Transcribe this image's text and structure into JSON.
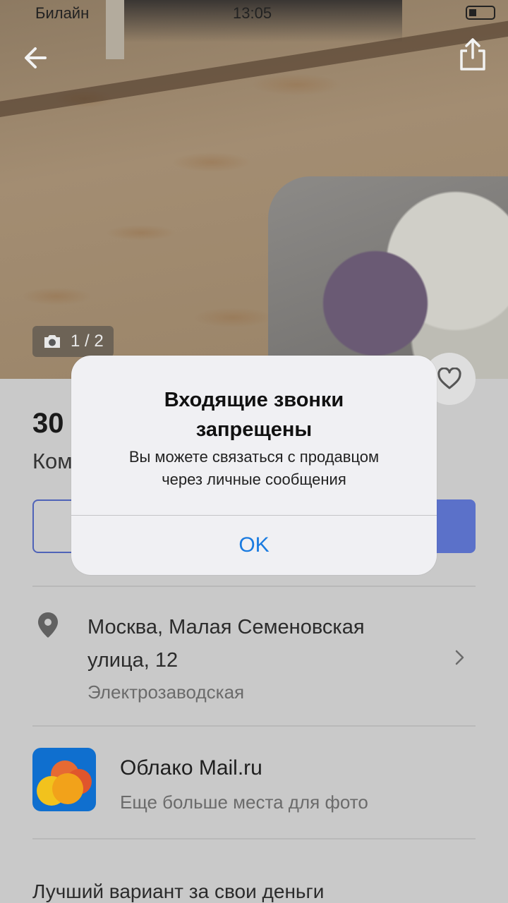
{
  "status_bar": {
    "carrier": "Билайн",
    "time": "13:05"
  },
  "gallery": {
    "counter": "1 / 2"
  },
  "listing": {
    "price": "30",
    "subtitle": "Ком"
  },
  "location": {
    "address_line1": "Москва, Малая Семеновская",
    "address_line2": "улица, 12",
    "metro": "Электрозаводская"
  },
  "promo": {
    "title": "Облако Mail.ru",
    "subtitle": "Еще больше места для фото"
  },
  "description": {
    "first_line": "Лучший вариант за свои деньги"
  },
  "alert": {
    "title_line1": "Входящие звонки",
    "title_line2": "запрещены",
    "message_line1": "Вы можете связаться с продавцом",
    "message_line2": "через личные сообщения",
    "ok_label": "OK"
  },
  "colors": {
    "primary_blue": "#5b71c9",
    "alert_button": "#1a7be0",
    "cloud_icon_bg": "#0f6fcf"
  },
  "icons": [
    "back-arrow-icon",
    "share-icon",
    "camera-icon",
    "heart-icon",
    "location-pin-icon",
    "chevron-right-icon",
    "cloud-app-icon"
  ]
}
